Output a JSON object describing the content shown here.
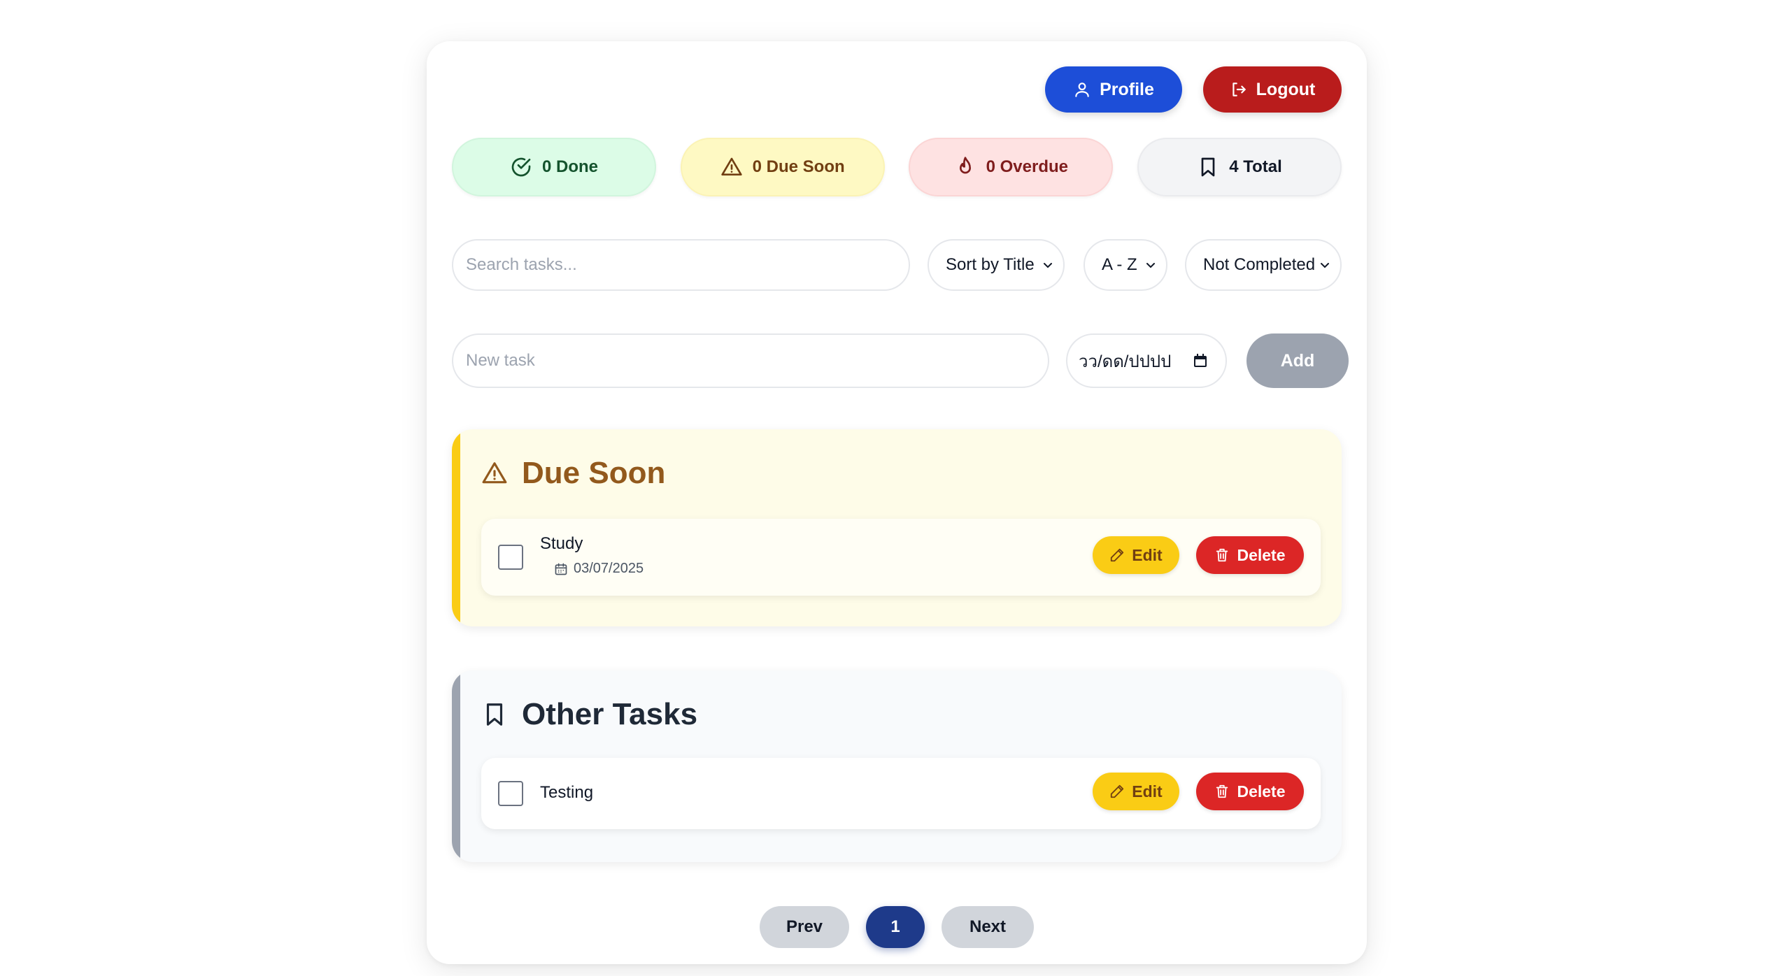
{
  "header": {
    "profile_label": "Profile",
    "logout_label": "Logout",
    "profile_color": "#1d4ed8",
    "logout_color": "#b91c1c"
  },
  "stats": {
    "done": "0 Done",
    "due_soon": "0 Due Soon",
    "overdue": "0 Overdue",
    "total": "4 Total"
  },
  "filters": {
    "search_placeholder": "Search tasks...",
    "sort_by": "Sort by Title",
    "order": "A - Z",
    "status": "Not Completed"
  },
  "new_task": {
    "placeholder": "New task",
    "date_placeholder": "วว/ดด/ปปปป",
    "add_label": "Add"
  },
  "sections": {
    "due_soon": {
      "title": "Due Soon",
      "accent": "#facc15",
      "tasks": [
        {
          "name": "Study",
          "date": "03/07/2025",
          "completed": false,
          "edit_label": "Edit",
          "delete_label": "Delete"
        }
      ]
    },
    "other": {
      "title": "Other Tasks",
      "accent": "#9ca3af",
      "tasks": [
        {
          "name": "Testing",
          "completed": false,
          "edit_label": "Edit",
          "delete_label": "Delete"
        }
      ]
    }
  },
  "pagination": {
    "prev_label": "Prev",
    "current_page": "1",
    "next_label": "Next"
  },
  "icons": {
    "profile": "user-icon",
    "logout": "logout-icon",
    "done": "check-circle-icon",
    "due_soon": "warning-triangle-icon",
    "overdue": "flame-icon",
    "total": "bookmark-icon",
    "calendar": "calendar-icon",
    "edit": "pencil-icon",
    "delete": "trash-icon"
  }
}
